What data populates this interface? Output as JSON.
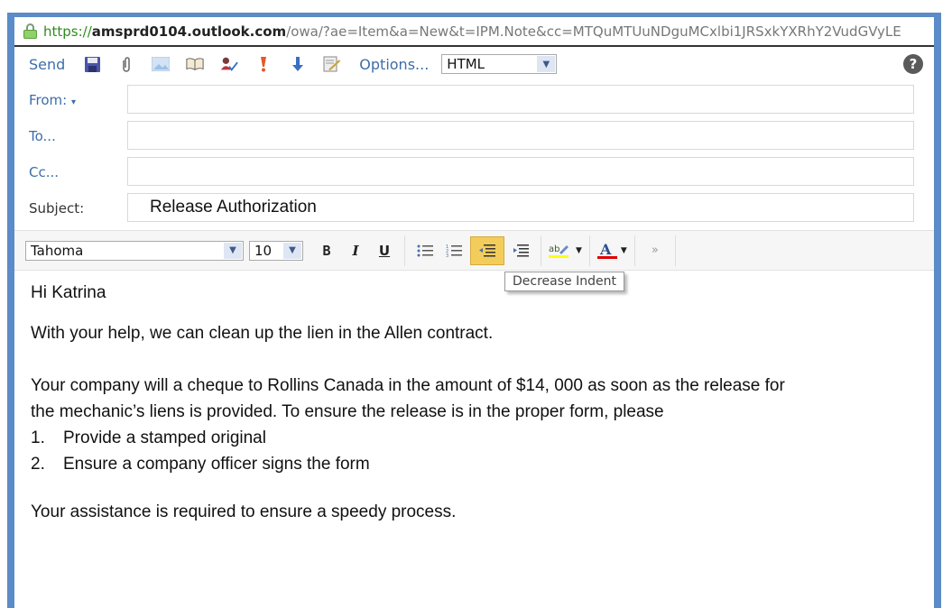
{
  "browser": {
    "url_protocol": "https://",
    "url_host": "amsprd0104.outlook.com",
    "url_path": "/owa/?ae=Item&a=New&t=IPM.Note&cc=MTQuMTUuNDguMCxlbi1JRSxkYXRhY2VudGVyLE"
  },
  "toolbar": {
    "send_label": "Send",
    "options_label": "Options...",
    "format_value": "HTML",
    "icons": [
      "save-icon",
      "attach-icon",
      "insert-image-icon",
      "address-book-icon",
      "check-names-icon",
      "high-importance-icon",
      "low-importance-icon",
      "signature-icon"
    ],
    "help_label": "?"
  },
  "fields": {
    "from_label": "From:",
    "from_value": "",
    "to_label": "To...",
    "to_value": "",
    "cc_label": "Cc...",
    "cc_value": "",
    "subject_label": "Subject:",
    "subject_value": "Release Authorization"
  },
  "format_toolbar": {
    "font_value": "Tahoma",
    "size_value": "10",
    "bold": "B",
    "italic": "I",
    "underline": "U",
    "tooltip": "Decrease Indent",
    "highlight_color": "#ffff00",
    "font_color": "#e00000"
  },
  "message": {
    "greeting": "Hi Katrina",
    "para1": "With your help, we can clean up the lien in the Allen contract.",
    "para2_line1": "Your company will a cheque to Rollins Canada in the amount of $14, 000 as soon as the release for",
    "para2_line2": "the mechanic’s liens is provided. To ensure the release is in the proper form, please",
    "list": [
      {
        "num": "1.",
        "text": "Provide a stamped original"
      },
      {
        "num": "2.",
        "text": "Ensure a company officer signs the form"
      }
    ],
    "closing": "Your assistance is required to ensure a speedy process."
  }
}
